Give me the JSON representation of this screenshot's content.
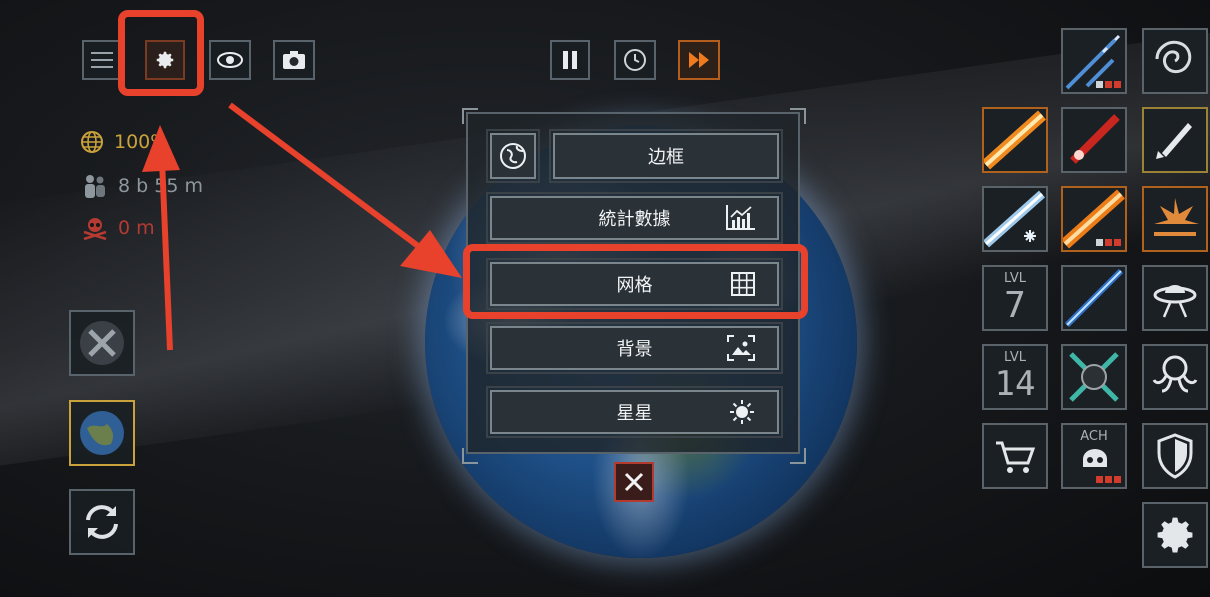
{
  "top_left_buttons": {
    "menu_icon": "menu-icon",
    "settings_icon": "gear-icon",
    "view_icon": "eye-icon",
    "camera_icon": "camera-icon"
  },
  "top_center_buttons": {
    "pause_icon": "pause-icon",
    "time_icon": "clock-icon",
    "speed_icon": "fast-forward-icon"
  },
  "stats": {
    "population_percent": "100%",
    "population_count": "8 b 55 m",
    "deaths": "0 m"
  },
  "menu": {
    "items": [
      {
        "label": "边框",
        "icon": "globe-icon"
      },
      {
        "label": "統計數據",
        "icon": "bar-chart-icon"
      },
      {
        "label": "网格",
        "icon": "grid-icon"
      },
      {
        "label": "背景",
        "icon": "image-icon"
      },
      {
        "label": "星星",
        "icon": "sun-icon"
      }
    ],
    "close_icon": "close-icon"
  },
  "right_tiles": {
    "lvl_label": "LVL",
    "lvl_a": "7",
    "lvl_b": "14",
    "ach_label": "ACH"
  },
  "colors": {
    "highlight": "#e8412c",
    "panel_border": "#59636b",
    "gold": "#c9a23c",
    "red_stat": "#b43a32"
  }
}
